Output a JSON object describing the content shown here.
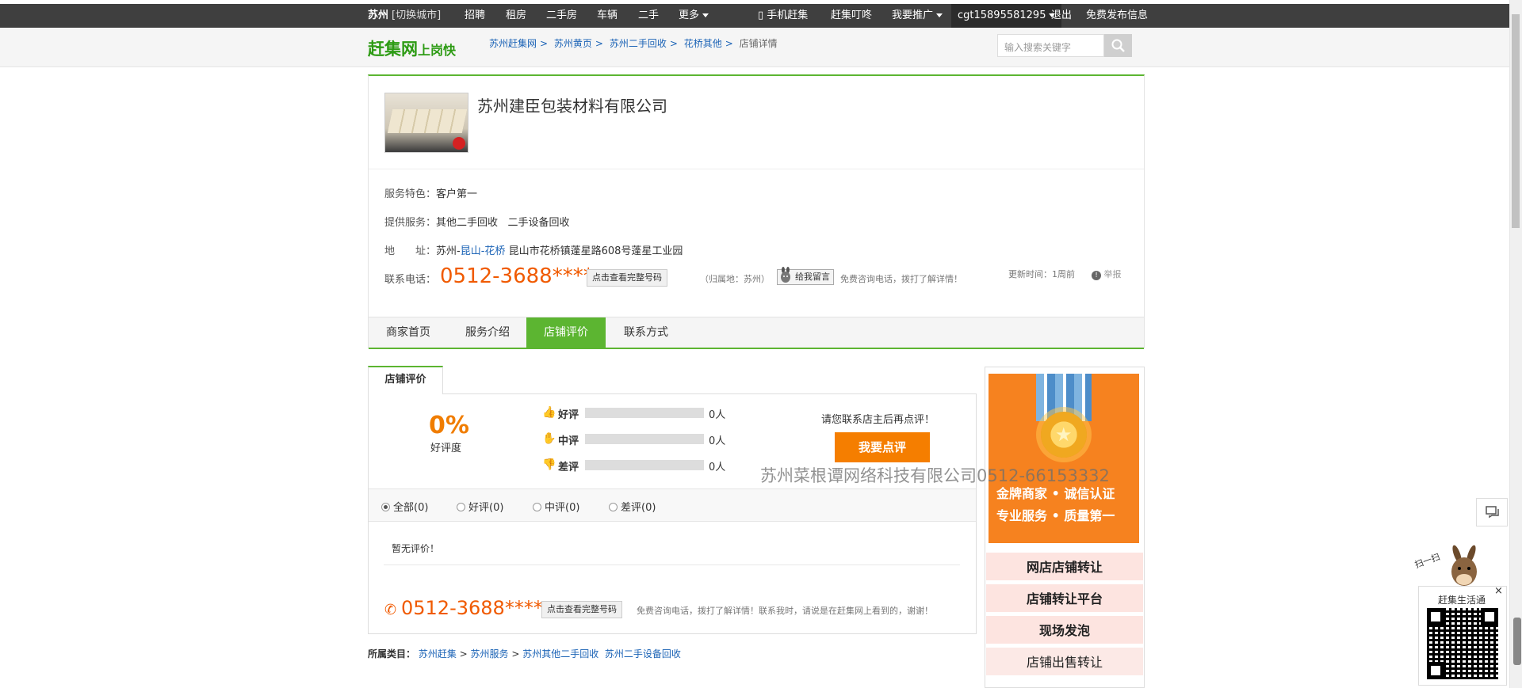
{
  "topbar": {
    "city": "苏州",
    "switch_city": "[切换城市]",
    "nav": [
      "招聘",
      "租房",
      "二手房",
      "车辆",
      "二手",
      "更多"
    ],
    "mobile": "手机赶集",
    "ding": "赶集叮咚",
    "promote": "我要推广",
    "user": "cgt15895581295",
    "logout": "退出",
    "free_post": "免费发布信息"
  },
  "header": {
    "logo_main": "赶集网",
    "logo_sub": "上岗快",
    "breadcrumbs": [
      "苏州赶集网",
      "苏州黄页",
      "苏州二手回收",
      "花桥其他",
      "店铺详情"
    ],
    "search_placeholder": "输入搜索关键字"
  },
  "shop": {
    "name": "苏州建臣包装材料有限公司",
    "feature_label": "服务特色：",
    "feature_value": "客户第一",
    "services_label": "提供服务：",
    "services": [
      "其他二手回收",
      "二手设备回收"
    ],
    "address_label": "地　　址：",
    "address_city": "苏州-",
    "address_district": "昆山-花桥",
    "address_detail": "昆山市花桥镇蓬星路608号蓬星工业园",
    "phone_label": "联系电话：",
    "phone": "0512-3688****",
    "view_full_number": "点击查看完整号码",
    "belong": "（归属地：苏州）",
    "leave_message": "给我留言",
    "free_consult": "免费咨询电话，拨打了解详情！",
    "update_time": "更新时间：1周前",
    "report": "举报"
  },
  "tabs": [
    "商家首页",
    "服务介绍",
    "店铺评价",
    "联系方式"
  ],
  "review": {
    "tab_title": "店铺评价",
    "rate": "0%",
    "rate_label": "好评度",
    "rows": [
      {
        "label": "好评",
        "count": "0人",
        "icon": "thumbs-up-icon",
        "fill": 0
      },
      {
        "label": "中评",
        "count": "0人",
        "icon": "hand-icon",
        "fill": 0
      },
      {
        "label": "差评",
        "count": "0人",
        "icon": "thumbs-down-icon",
        "fill": 0
      }
    ],
    "ask_note": "请您联系店主后再点评！",
    "review_button": "我要点评",
    "filters": [
      "全部(0)",
      "好评(0)",
      "中评(0)",
      "差评(0)"
    ],
    "empty": "暂无评价！",
    "phone": "0512-3688****",
    "view_full_number": "点击查看完整号码",
    "footer_note": "免费咨询电话，拨打了解详情！联系我时，请说是在赶集网上看到的，谢谢！"
  },
  "watermark": "苏州菜根谭网络科技有限公司0512-66153332",
  "category": {
    "label": "所属类目：",
    "links": [
      "苏州赶集",
      "苏州服务",
      "苏州其他二手回收",
      "苏州二手设备回收"
    ]
  },
  "ad": {
    "line1": "金牌商家 • 诚信认证",
    "line2": "专业服务 • 质量第一"
  },
  "side_links": [
    "网店店铺转让",
    "店铺转让平台",
    "现场发泡",
    "店铺出售转让"
  ],
  "float": {
    "scan": "扫一扫",
    "qr_title": "赶集生活通",
    "close": "×"
  },
  "colors": {
    "green": "#5cb531",
    "orange": "#f05a00",
    "link": "#1b63b6"
  }
}
